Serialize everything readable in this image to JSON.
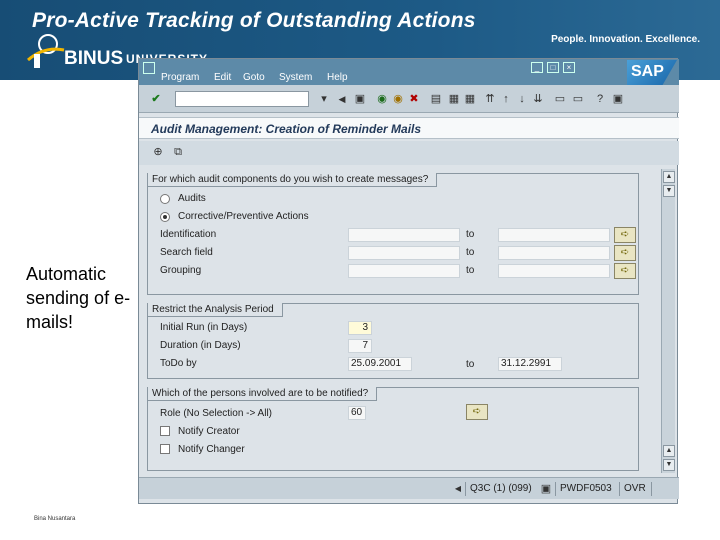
{
  "slide": {
    "title": "Pro-Active Tracking of Outstanding Actions",
    "tagline": "People. Innovation. Excellence.",
    "logo_main": "BINUS",
    "logo_sub": "UNIVERSITY",
    "side_text": "Automatic sending of e-mails!",
    "footer": "Bina Nusantara"
  },
  "sap": {
    "menu": [
      "Program",
      "Edit",
      "Goto",
      "System",
      "Help"
    ],
    "brand": "SAP",
    "title": "Audit Management: Creation of Reminder Mails",
    "command_field": "",
    "group1": {
      "title": "For which audit components do you wish to create messages?",
      "radio_audits": "Audits",
      "radio_cpa": "Corrective/Preventive Actions",
      "rows": [
        {
          "label": "Identification",
          "to": "to"
        },
        {
          "label": "Search field",
          "to": "to"
        },
        {
          "label": "Grouping",
          "to": "to"
        }
      ]
    },
    "group2": {
      "title": "Restrict the Analysis Period",
      "initial_run_label": "Initial Run (in Days)",
      "initial_run_value": "3",
      "duration_label": "Duration (in Days)",
      "duration_value": "7",
      "todo_label": "ToDo by",
      "todo_from": "25.09.2001",
      "todo_to_label": "to",
      "todo_to": "31.12.2991"
    },
    "group3": {
      "title": "Which of the persons involved are to be notified?",
      "role_label": "Role (No Selection -> All)",
      "role_value": "60",
      "notify_creator": "Notify Creator",
      "notify_changer": "Notify Changer"
    },
    "status": {
      "system": "Q3C (1) (099)",
      "server": "PWDF0503",
      "mode": "OVR"
    }
  }
}
